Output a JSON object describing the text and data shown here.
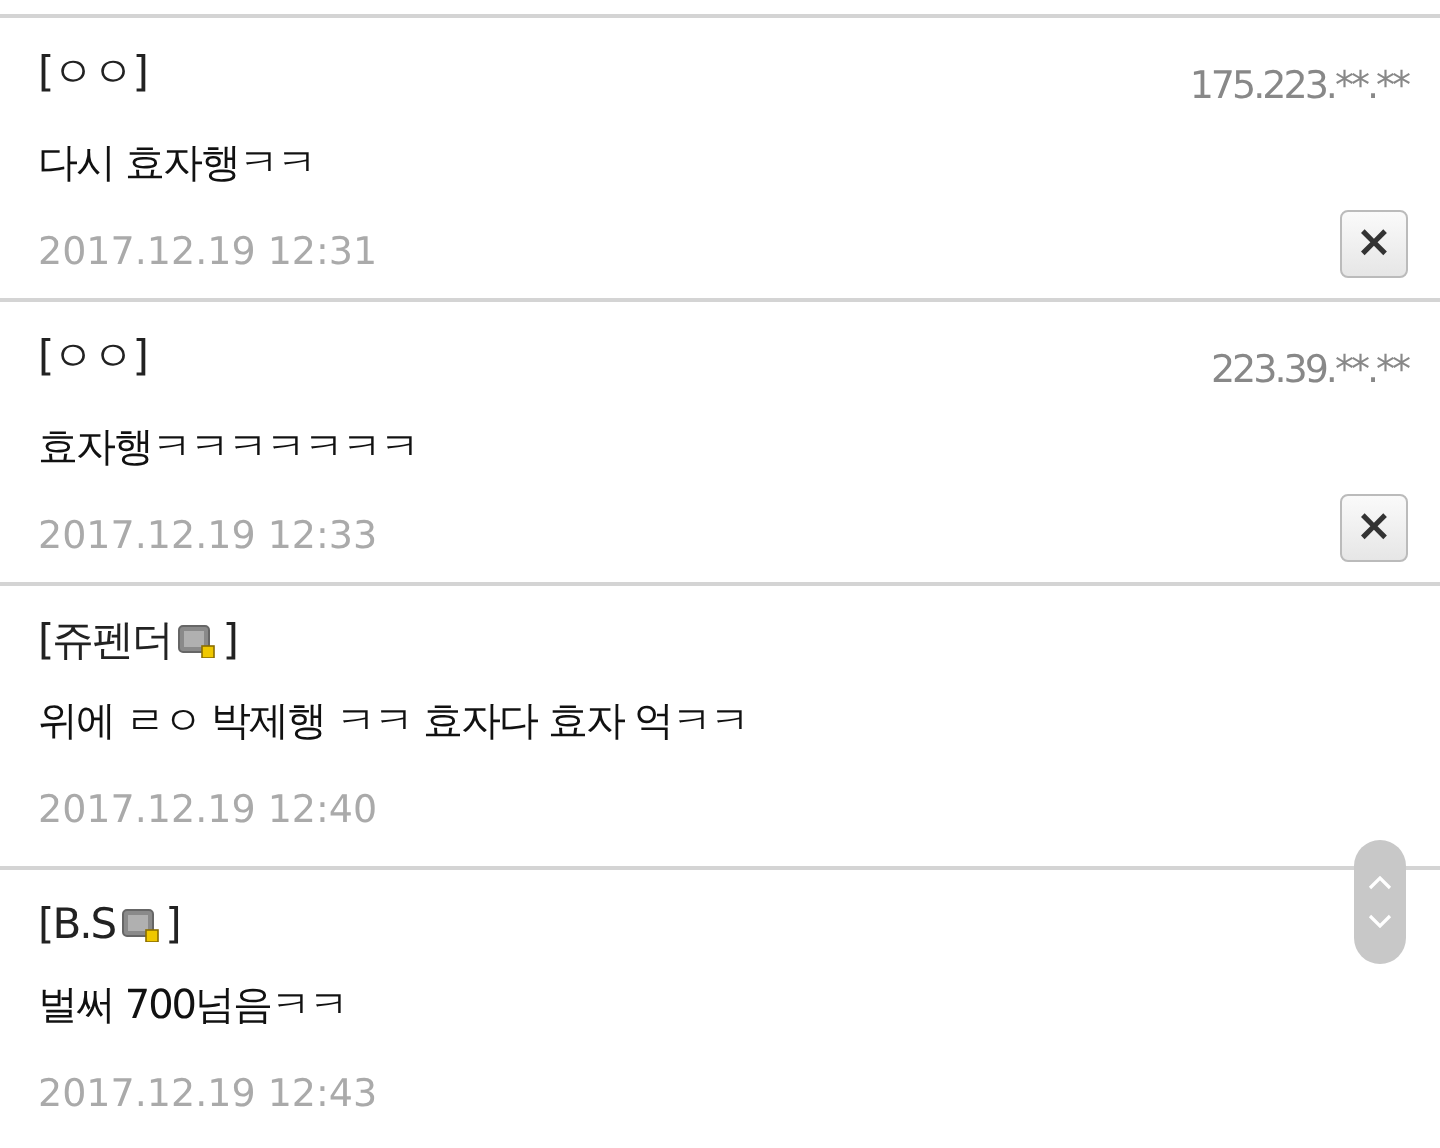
{
  "comments": [
    {
      "kind": "anonymous",
      "author": "[ㅇㅇ]",
      "ip": "175.223.**.**",
      "text": "다시 효자행ㅋㅋ",
      "date": "2017.12.19 12:31",
      "delete_label": "×"
    },
    {
      "kind": "anonymous",
      "author": "[ㅇㅇ]",
      "ip": "223.39.**.**",
      "text": "효자행ㅋㅋㅋㅋㅋㅋㅋ",
      "date": "2017.12.19 12:33",
      "delete_label": "×"
    },
    {
      "kind": "member",
      "author": "[쥬펜더",
      "author_end": "]",
      "text": "위에 ㄹㅇ 박제행 ㅋㅋ 효자다 효자 억ㅋㅋ",
      "date": "2017.12.19 12:40"
    },
    {
      "kind": "member",
      "author": "[B.S",
      "author_end": "]",
      "text": "벌써 700넘음ㅋㅋ",
      "date": "2017.12.19 12:43"
    }
  ]
}
